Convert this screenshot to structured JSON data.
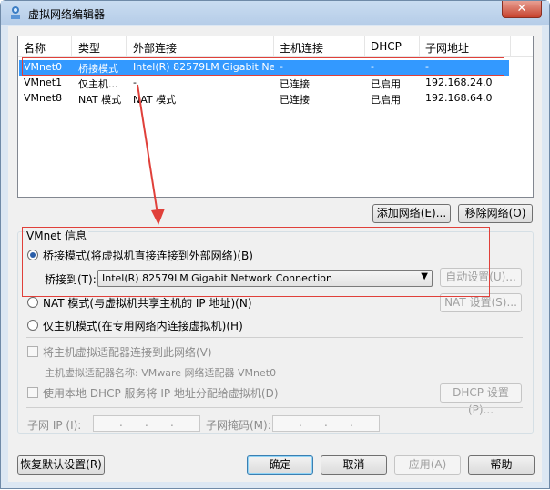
{
  "window": {
    "title": "虚拟网络编辑器",
    "close_symbol": "✕"
  },
  "table": {
    "headers": [
      "名称",
      "类型",
      "外部连接",
      "主机连接",
      "DHCP",
      "子网地址"
    ],
    "rows": [
      [
        "VMnet0",
        "桥接模式",
        "Intel(R) 82579LM Gigabit Ne...",
        "-",
        "-",
        "-"
      ],
      [
        "VMnet1",
        "仅主机...",
        "-",
        "已连接",
        "已启用",
        "192.168.24.0"
      ],
      [
        "VMnet8",
        "NAT 模式",
        "NAT 模式",
        "已连接",
        "已启用",
        "192.168.64.0"
      ]
    ],
    "selected_row": 0
  },
  "list_buttons": {
    "add": "添加网络(E)...",
    "remove": "移除网络(O)"
  },
  "vmnet_info": {
    "title": "VMnet 信息",
    "bridge_radio": "桥接模式(将虚拟机直接连接到外部网络)(B)",
    "bridge_to_label": "桥接到(T):",
    "bridge_to_value": "Intel(R) 82579LM Gigabit Network Connection",
    "auto_settings": "自动设置(U)...",
    "nat_radio": "NAT 模式(与虚拟机共享主机的 IP 地址)(N)",
    "nat_settings": "NAT 设置(S)...",
    "hostonly_radio": "仅主机模式(在专用网络内连接虚拟机)(H)",
    "connect_adapter": "将主机虚拟适配器连接到此网络(V)",
    "adapter_name": "主机虚拟适配器名称: VMware 网络适配器 VMnet0",
    "use_dhcp": "使用本地 DHCP 服务将 IP 地址分配给虚拟机(D)",
    "dhcp_settings": "DHCP 设置(P)...",
    "subnet_ip_label": "子网 IP (I):",
    "subnet_mask_label": "子网掩码(M):",
    "selected_mode": "bridge"
  },
  "footer": {
    "restore": "恢复默认设置(R)",
    "ok": "确定",
    "cancel": "取消",
    "apply": "应用(A)",
    "help": "帮助"
  },
  "colors": {
    "selection": "#3399ff",
    "annotation": "#e0403a"
  }
}
